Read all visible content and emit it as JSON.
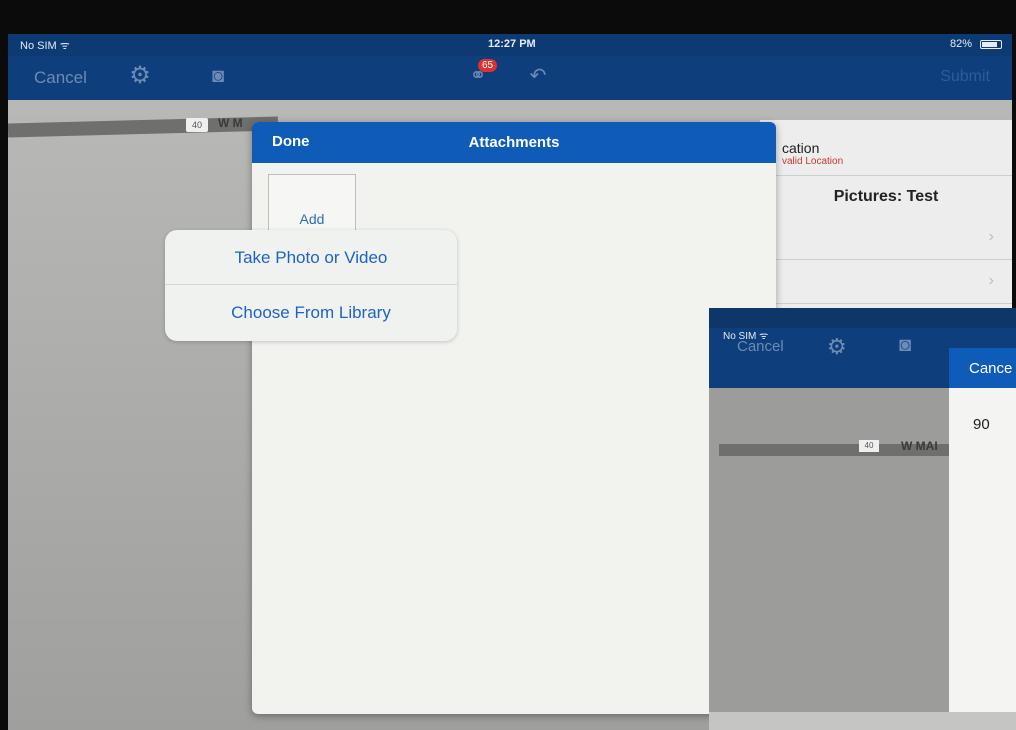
{
  "status_bar": {
    "carrier": "No SIM ᯤ",
    "time": "12:27 PM",
    "battery": "82%"
  },
  "nav": {
    "cancel_label": "Cancel",
    "badge_count": "65",
    "right_label": "Submit"
  },
  "map": {
    "route_shield": "40",
    "street_label": "W M"
  },
  "form": {
    "location_title": "cation",
    "location_subtitle": "valid Location",
    "pictures_title": "Pictures: Test"
  },
  "attachments": {
    "done_label": "Done",
    "title": "Attachments",
    "add_label": "Add"
  },
  "popover": {
    "items": [
      {
        "label": "Take Photo or Video"
      },
      {
        "label": "Choose From Library"
      }
    ]
  },
  "inset": {
    "carrier": "No SIM ᯤ",
    "cancel_label": "Cancel",
    "modal_cancel_label": "Cance",
    "input_value": "90",
    "route_shield": "40",
    "street_label": "W MAI"
  }
}
